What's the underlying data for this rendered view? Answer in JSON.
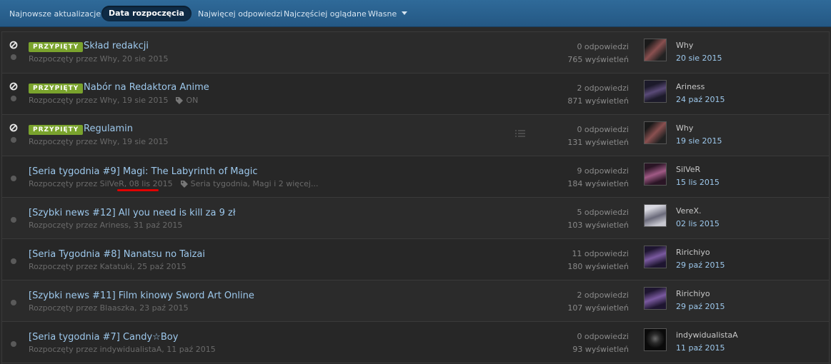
{
  "tabs": [
    {
      "label": "Najnowsze aktualizacje"
    },
    {
      "label": "Data rozpoczęcia",
      "active": true
    },
    {
      "label": "Najwięcej odpowiedzi"
    },
    {
      "label": "Najczęściej oglądane"
    },
    {
      "label": "Własne"
    }
  ],
  "pinned_label": "PRZYPIĘTY",
  "topics": [
    {
      "title": "Skład redakcji",
      "started_by": "Rozpoczęty przez Why, 20 sie 2015",
      "replies": "0 odpowiedzi",
      "views": "765 wyświetleń",
      "last_user": "Why",
      "last_date": "20 sie 2015",
      "avatar_color": "#5b3a3a"
    },
    {
      "title": "Nabór na Redaktora Anime",
      "started_by": "Rozpoczęty przez Why, 19 sie 2015",
      "tags": "ON",
      "replies": "2 odpowiedzi",
      "views": "871 wyświetleń",
      "last_user": "Ariness",
      "last_date": "24 paź 2015",
      "avatar_color": "#3a3550"
    },
    {
      "title": "Regulamin",
      "started_by": "Rozpoczęty przez Why, 19 sie 2015",
      "replies": "0 odpowiedzi",
      "views": "131 wyświetleń",
      "last_user": "Why",
      "last_date": "19 sie 2015",
      "avatar_color": "#5b3a3a"
    },
    {
      "title": "[Seria tygodnia #9] Magi: The Labyrinth of Magic",
      "started_by_prefix": "Rozpoczęty przez SilVeR, ",
      "started_by_date": "08 lis 2015",
      "tags": "Seria tygodnia, Magi i 2 więcej...",
      "replies": "9 odpowiedzi",
      "views": "184 wyświetleń",
      "last_user": "SilVeR",
      "last_date": "15 lis 2015",
      "avatar_color": "#6a3a55"
    },
    {
      "title": "[Szybki news #12] All you need is kill za 9 zł",
      "started_by": "Rozpoczęty przez Ariness, 31 paź 2015",
      "replies": "5 odpowiedzi",
      "views": "103 wyświetleń",
      "last_user": "VereX.",
      "last_date": "02 lis 2015",
      "avatar_color": "#8a8a98"
    },
    {
      "title": "[Seria Tygodnia #8] Nanatsu no Taizai",
      "started_by": "Rozpoczęty przez Katatuki, 25 paź 2015",
      "replies": "11 odpowiedzi",
      "views": "180 wyświetleń",
      "last_user": "Ririchiyo",
      "last_date": "29 paź 2015",
      "avatar_color": "#4a3566"
    },
    {
      "title": "[Szybki news #11] Film kinowy Sword Art Online",
      "started_by": "Rozpoczęty przez Blaaszka, 23 paź 2015",
      "replies": "2 odpowiedzi",
      "views": "107 wyświetleń",
      "last_user": "Ririchiyo",
      "last_date": "29 paź 2015",
      "avatar_color": "#4a3566"
    },
    {
      "title": "[Seria tygodnia #7] Candy☆Boy",
      "started_by": "Rozpoczęty przez indywidualistaA, 11 paź 2015",
      "replies": "0 odpowiedzi",
      "views": "93 wyświetleń",
      "last_user": "indywidualistaA",
      "last_date": "11 paź 2015",
      "avatar_color": "#151515"
    }
  ]
}
